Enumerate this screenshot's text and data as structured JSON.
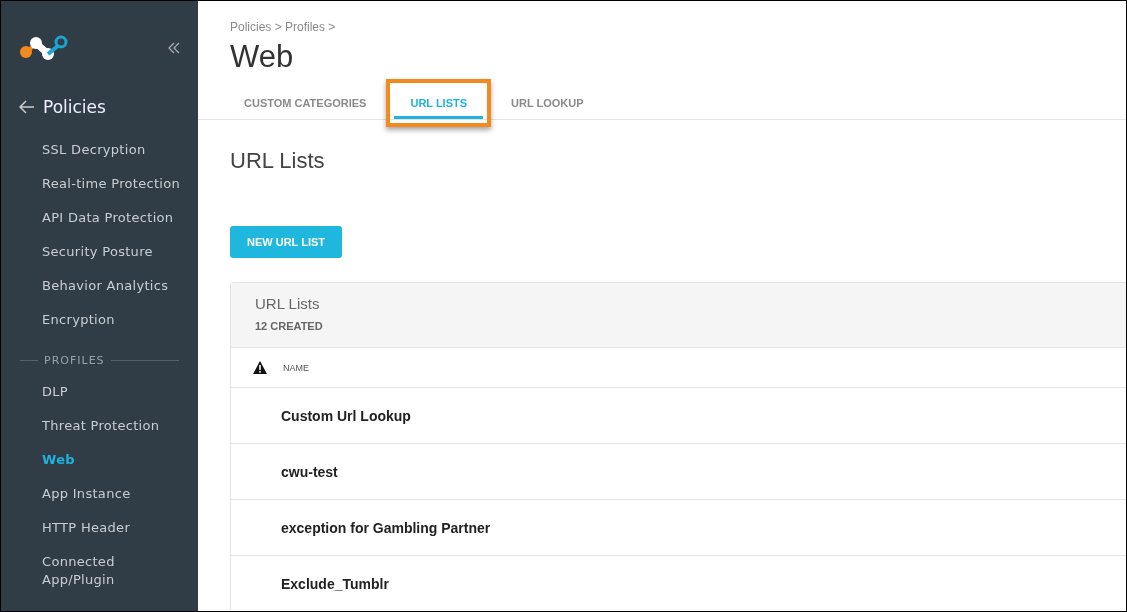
{
  "sidebar": {
    "back_label": "Policies",
    "items": [
      {
        "kind": "item",
        "label": "SSL Decryption",
        "selected": false
      },
      {
        "kind": "item",
        "label": "Real-time Protection",
        "selected": false
      },
      {
        "kind": "item",
        "label": "API Data Protection",
        "selected": false
      },
      {
        "kind": "item",
        "label": "Security Posture",
        "selected": false
      },
      {
        "kind": "item",
        "label": "Behavior Analytics",
        "selected": false
      },
      {
        "kind": "item",
        "label": "Encryption",
        "selected": false
      },
      {
        "kind": "section",
        "label": "PROFILES"
      },
      {
        "kind": "item",
        "label": "DLP",
        "selected": false
      },
      {
        "kind": "item",
        "label": "Threat Protection",
        "selected": false
      },
      {
        "kind": "item",
        "label": "Web",
        "selected": true
      },
      {
        "kind": "item",
        "label": "App Instance",
        "selected": false
      },
      {
        "kind": "item",
        "label": "HTTP Header",
        "selected": false
      },
      {
        "kind": "item",
        "label": "Connected App/Plugin",
        "selected": false
      }
    ]
  },
  "breadcrumb": "Policies > Profiles >",
  "page_title": "Web",
  "tabs": [
    {
      "label": "CUSTOM CATEGORIES",
      "selected": false,
      "highlighted": false
    },
    {
      "label": "URL LISTS",
      "selected": true,
      "highlighted": true
    },
    {
      "label": "URL LOOKUP",
      "selected": false,
      "highlighted": false
    }
  ],
  "section_title": "URL Lists",
  "new_button": "NEW URL LIST",
  "table": {
    "title": "URL Lists",
    "count": "12 CREATED",
    "columns": [
      "NAME"
    ],
    "rows": [
      {
        "name": "Custom Url Lookup"
      },
      {
        "name": "cwu-test"
      },
      {
        "name": "exception for Gambling Partner"
      },
      {
        "name": "Exclude_Tumblr"
      }
    ]
  }
}
